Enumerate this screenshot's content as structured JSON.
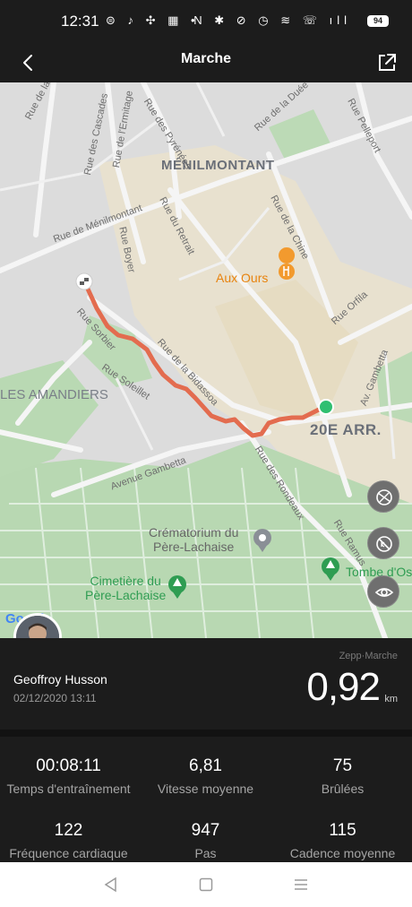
{
  "status_bar": {
    "time": "12:31",
    "left_icons": "⊜ ♪ ✣ ▦ •",
    "right_icons": "N ✱ ⊘ ◷ ≋ ☏ ıll",
    "battery": "94"
  },
  "header": {
    "title": "Marche"
  },
  "map": {
    "labels": {
      "menilmontant": "MÉNILMONTANT",
      "amandiers": "LES AMANDIERS",
      "arrondissement": "20E ARR.",
      "aux_ours": "Aux Ours",
      "crematorium": "Crématorium du\nPère-Lachaise",
      "cimetiere": "Cimetière du\nPère-Lachaise",
      "tombe": "Tombe d'Os",
      "rue_mare": "Rue de la Mare",
      "rue_cascades": "Rue des Cascades",
      "rue_ermitage": "Rue de l'Ermitage",
      "rue_pyrenees": "Rue des Pyrénées",
      "rue_duee": "Rue de la Duée",
      "rue_pelleport": "Rue Pelleport",
      "rue_menilmontant": "Rue de Ménilmontant",
      "rue_retrait": "Rue du Retrait",
      "rue_boyer": "Rue Boyer",
      "rue_chine": "Rue de la Chine",
      "rue_orfila": "Rue Orfila",
      "rue_sorbier": "Rue Sorbier",
      "rue_soleillet": "Rue Soleillet",
      "rue_bidassoa": "Rue de la Bidassoa",
      "av_gambetta_right": "Av. Gambetta",
      "avenue_gambetta": "Avenue Gambetta",
      "rue_rondeaux": "Rue des Rondeaux",
      "rue_ramus": "Rue Ramus",
      "google": "Google"
    },
    "colors": {
      "route": "#e36c4f",
      "end_marker": "#2fbf71",
      "park": "#a9d3a4"
    }
  },
  "activity": {
    "user_name": "Geoffroy Husson",
    "date": "02/12/2020 13:11",
    "source": "Zepp·Marche",
    "distance": "0,92",
    "distance_unit": "km"
  },
  "stats": [
    {
      "value": "00:08:11",
      "label": "Temps d'entraînement"
    },
    {
      "value": "6,81",
      "label": "Vitesse moyenne"
    },
    {
      "value": "75",
      "label": "Brûlées"
    },
    {
      "value": "122",
      "label": "Fréquence cardiaque"
    },
    {
      "value": "947",
      "label": "Pas"
    },
    {
      "value": "115",
      "label": "Cadence moyenne"
    }
  ]
}
